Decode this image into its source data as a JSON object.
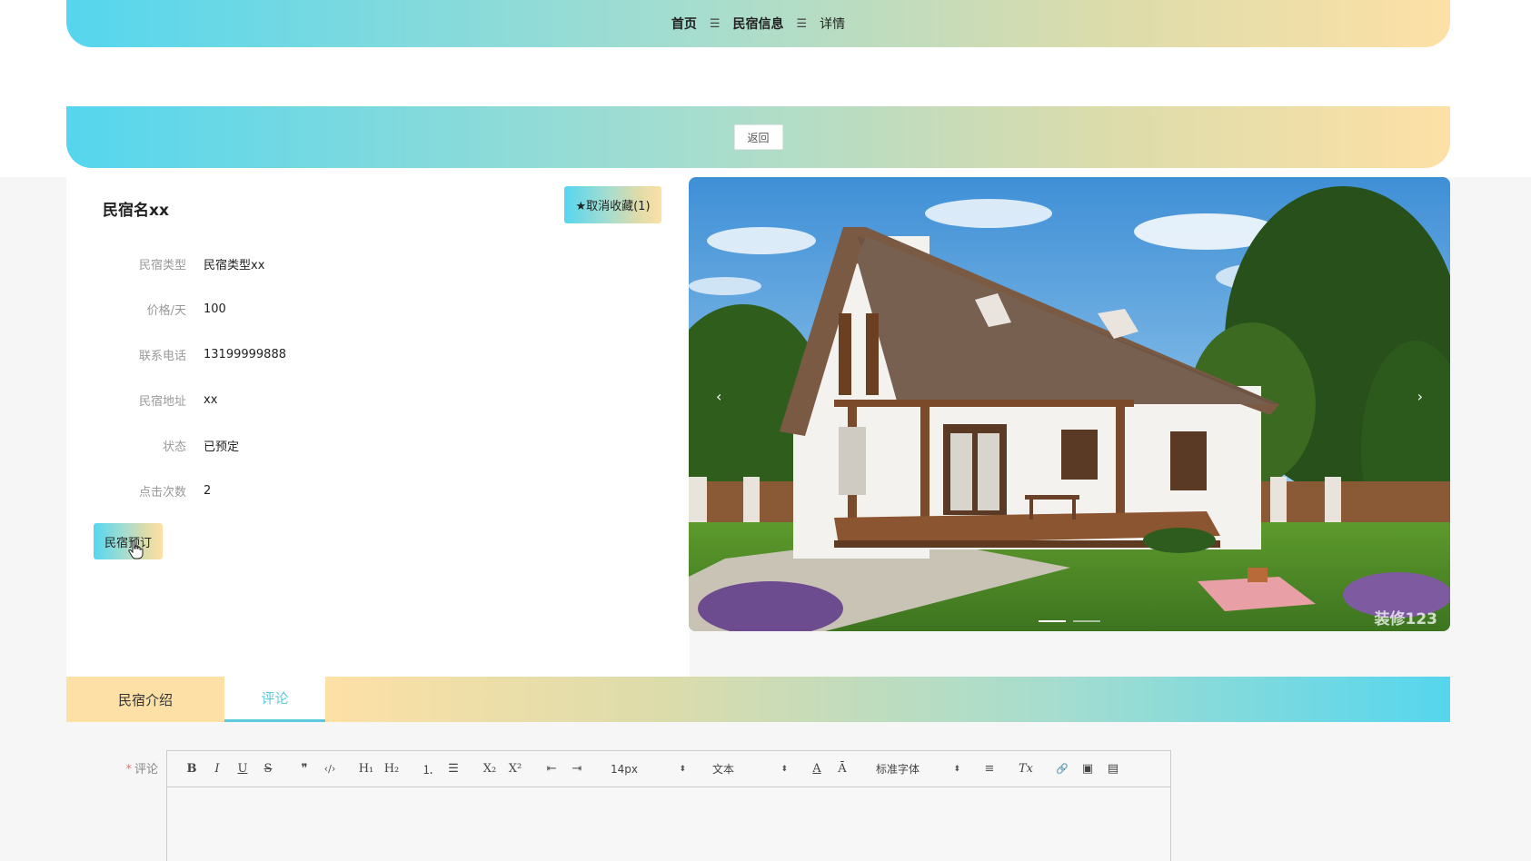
{
  "breadcrumb": {
    "home": "首页",
    "separator": "☰",
    "section": "民宿信息",
    "current": "详情"
  },
  "back_button": "返回",
  "listing": {
    "name": "民宿名xx",
    "favorite_label": "★取消收藏(1)",
    "fields": [
      {
        "label": "民宿类型",
        "value": "民宿类型xx"
      },
      {
        "label": "价格/天",
        "value": "100"
      },
      {
        "label": "联系电话",
        "value": "13199999888"
      },
      {
        "label": "民宿地址",
        "value": "xx"
      },
      {
        "label": "状态",
        "value": "已预定"
      },
      {
        "label": "点击次数",
        "value": "2"
      }
    ],
    "book_button": "民宿预订"
  },
  "carousel": {
    "prev_arrow": "‹",
    "next_arrow": "›",
    "slide_count": 2,
    "active_slide": 1,
    "watermark": "装修123"
  },
  "tabs": [
    {
      "label": "民宿介绍",
      "active": false
    },
    {
      "label": "评论",
      "active": true
    }
  ],
  "comment": {
    "required_mark": "*",
    "label": "评论"
  },
  "editor_toolbar": {
    "bold": "B",
    "italic": "I",
    "underline": "U",
    "strike": "S",
    "quote": "❞",
    "code": "‹/›",
    "h1": "H₁",
    "h2": "H₂",
    "ordered_list": "⒈",
    "bullet_list": "☰",
    "subscript": "X₂",
    "superscript": "X²",
    "outdent": "⇤",
    "indent": "⇥",
    "size": "14px",
    "header": "文本",
    "font_color": "A",
    "background": "Ā",
    "font": "标准字体",
    "align": "≡",
    "clean": "Tx",
    "link": "🔗",
    "image": "▣",
    "video": "▤"
  },
  "colors": {
    "gradient_start": "#55d6ee",
    "gradient_end": "#fde0a6",
    "active_tab_text": "#5cc8dc"
  }
}
